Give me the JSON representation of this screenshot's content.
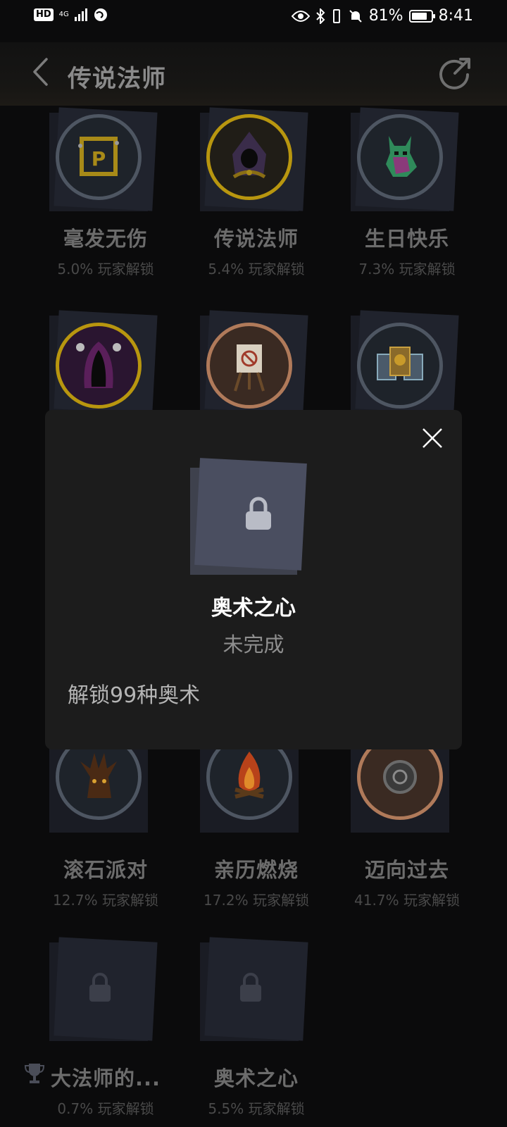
{
  "status_bar": {
    "hd": "HD",
    "network": "4G",
    "battery_percent": "81%",
    "battery_level": 0.81,
    "time": "8:41"
  },
  "header": {
    "title": "传说法师"
  },
  "achievements": [
    {
      "name": "毫发无伤",
      "pct": "5.0% 玩家解锁",
      "icon": "p-sign-icon"
    },
    {
      "name": "传说法师",
      "pct": "5.4% 玩家解锁",
      "icon": "hooded-wizard-icon"
    },
    {
      "name": "生日快乐",
      "pct": "7.3% 玩家解锁",
      "icon": "rainbow-horse-icon"
    },
    {
      "name": "",
      "pct": "",
      "icon": "purple-reaper-icon"
    },
    {
      "name": "",
      "pct": "",
      "icon": "easel-icon"
    },
    {
      "name": "",
      "pct": "",
      "icon": "spell-cards-icon"
    },
    {
      "name": "滚石派对",
      "pct": "12.7% 玩家解锁",
      "icon": "tree-monster-icon"
    },
    {
      "name": "亲历燃烧",
      "pct": "17.2% 玩家解锁",
      "icon": "campfire-icon"
    },
    {
      "name": "迈向过去",
      "pct": "41.7% 玩家解锁",
      "icon": "gear-flower-icon"
    },
    {
      "name": "大法师的...",
      "pct": "0.7% 玩家解锁",
      "icon": "lock-icon"
    },
    {
      "name": "奥术之心",
      "pct": "5.5% 玩家解锁",
      "icon": "lock-icon"
    }
  ],
  "modal": {
    "name": "奥术之心",
    "status": "未完成",
    "description": "解锁99种奥术"
  },
  "colors": {
    "gold_ring": "#b8960f",
    "gray_ring": "#4e5662",
    "copper_ring": "#b07a5a",
    "card": "#1a1c24",
    "modal_bg": "#1c1c1c"
  }
}
